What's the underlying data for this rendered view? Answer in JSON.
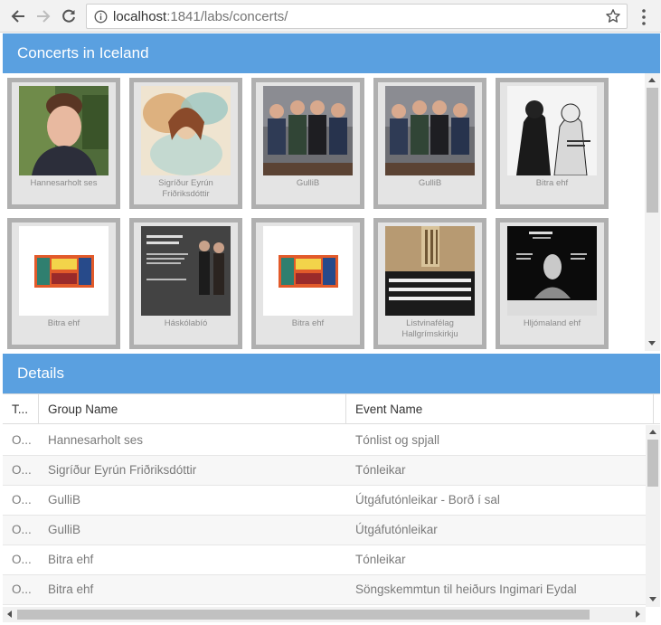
{
  "browser": {
    "url_host": "localhost",
    "url_rest": ":1841/labs/concerts/"
  },
  "concerts": {
    "title": "Concerts in Iceland",
    "tiles": [
      {
        "caption": "Hannesarholt ses",
        "thumb": "portrait"
      },
      {
        "caption": "Sigríður Eyrún Friðriksdóttir",
        "thumb": "artwork"
      },
      {
        "caption": "GulliB",
        "thumb": "band"
      },
      {
        "caption": "GulliB",
        "thumb": "band"
      },
      {
        "caption": "Bitra ehf",
        "thumb": "bw-duo"
      },
      {
        "caption": "Bitra ehf",
        "thumb": "poster"
      },
      {
        "caption": "Háskólabíó",
        "thumb": "dark-poster"
      },
      {
        "caption": "Bitra ehf",
        "thumb": "poster"
      },
      {
        "caption": "Listvinafélag Hallgrímskirkju",
        "thumb": "choir"
      },
      {
        "caption": "Hljómaland ehf",
        "thumb": "black-poster"
      }
    ]
  },
  "details": {
    "title": "Details",
    "columns": [
      "T...",
      "Group Name",
      "Event Name"
    ],
    "rows": [
      {
        "t": "O...",
        "group": "Hannesarholt ses",
        "event": "Tónlist og spjall"
      },
      {
        "t": "O...",
        "group": "Sigríður Eyrún Friðriksdóttir",
        "event": "Tónleikar"
      },
      {
        "t": "O...",
        "group": "GulliB",
        "event": "Útgáfutónleikar - Borð í sal"
      },
      {
        "t": "O...",
        "group": "GulliB",
        "event": "Útgáfutónleikar"
      },
      {
        "t": "O...",
        "group": "Bitra ehf",
        "event": "Tónleikar"
      },
      {
        "t": "O...",
        "group": "Bitra ehf",
        "event": "Söngskemmtun til heiðurs Ingimari Eydal"
      }
    ]
  },
  "colors": {
    "header_blue": "#5aa0e0",
    "tile_border": "#b0b0b0",
    "tile_bg": "#e4e4e4"
  }
}
